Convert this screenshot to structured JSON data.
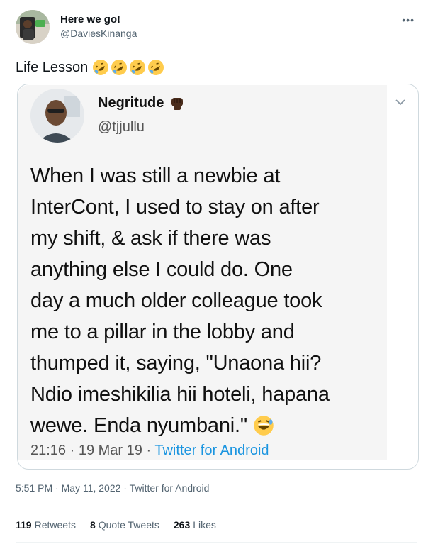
{
  "author": {
    "name": "Here we go!",
    "handle": "@DaviesKinanga"
  },
  "tweet": {
    "text": "Life Lesson",
    "emoji_icon": "rolling-on-floor-laughing-icon",
    "emoji_count": 4
  },
  "quoted": {
    "name": "Negritude",
    "name_icon": "raised-fist-icon",
    "handle": "@tjjullu",
    "body": "When I was still a newbie at\nInterCont, I used to stay on after\nmy shift, & ask if there was\nanything else I could do. One\nday a much older colleague took\nme to a pillar in the lobby and\nthumped it, saying, \"Unaona hii?\nNdio imeshikilia hii hoteli, hapana\nwewe. Enda nyumbani.\"",
    "body_end_icon": "grinning-squinting-sweat-icon",
    "time": "21:16",
    "date": "19 Mar 19",
    "source": "Twitter for Android"
  },
  "meta": {
    "time": "5:51 PM",
    "date": "May 11, 2022",
    "source": "Twitter for Android"
  },
  "stats": {
    "retweets_count": "119",
    "retweets_label": "Retweets",
    "quotes_count": "8",
    "quotes_label": "Quote Tweets",
    "likes_count": "263",
    "likes_label": "Likes"
  },
  "colors": {
    "accent": "#1b95e0",
    "secondary_text": "#536471",
    "border": "#cfd9de"
  }
}
